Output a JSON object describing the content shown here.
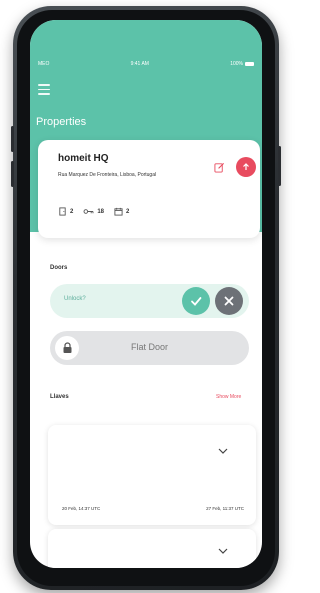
{
  "status_bar": {
    "carrier": "MEO",
    "time": "9:41 AM",
    "battery": "100%"
  },
  "header": {
    "title": "Properties"
  },
  "property": {
    "name": "homeit HQ",
    "address": "Rua Marquez De Fronteira, Lisboa, Portugal",
    "stats": {
      "doors": "2",
      "keys": "18",
      "bookings": "2"
    }
  },
  "doors_section": {
    "label": "Doors",
    "unlock_prompt": "Unlock?",
    "door_name": "Flat Door"
  },
  "llaves_section": {
    "label": "Llaves",
    "show_more": "Show More",
    "cards": [
      {
        "start": "20 Feb, 14:37 UTC",
        "end": "27 Feb, 11:37 UTC"
      },
      {}
    ]
  },
  "colors": {
    "accent": "#5cc2a9",
    "danger": "#e84b5f",
    "muted": "#6d7177",
    "unlock_bg": "#e3f4ee"
  },
  "icons": [
    "menu-icon",
    "edit-icon",
    "share-icon",
    "door-icon",
    "key-icon",
    "calendar-icon",
    "check-icon",
    "close-icon",
    "lock-icon",
    "chevron-down-icon"
  ]
}
